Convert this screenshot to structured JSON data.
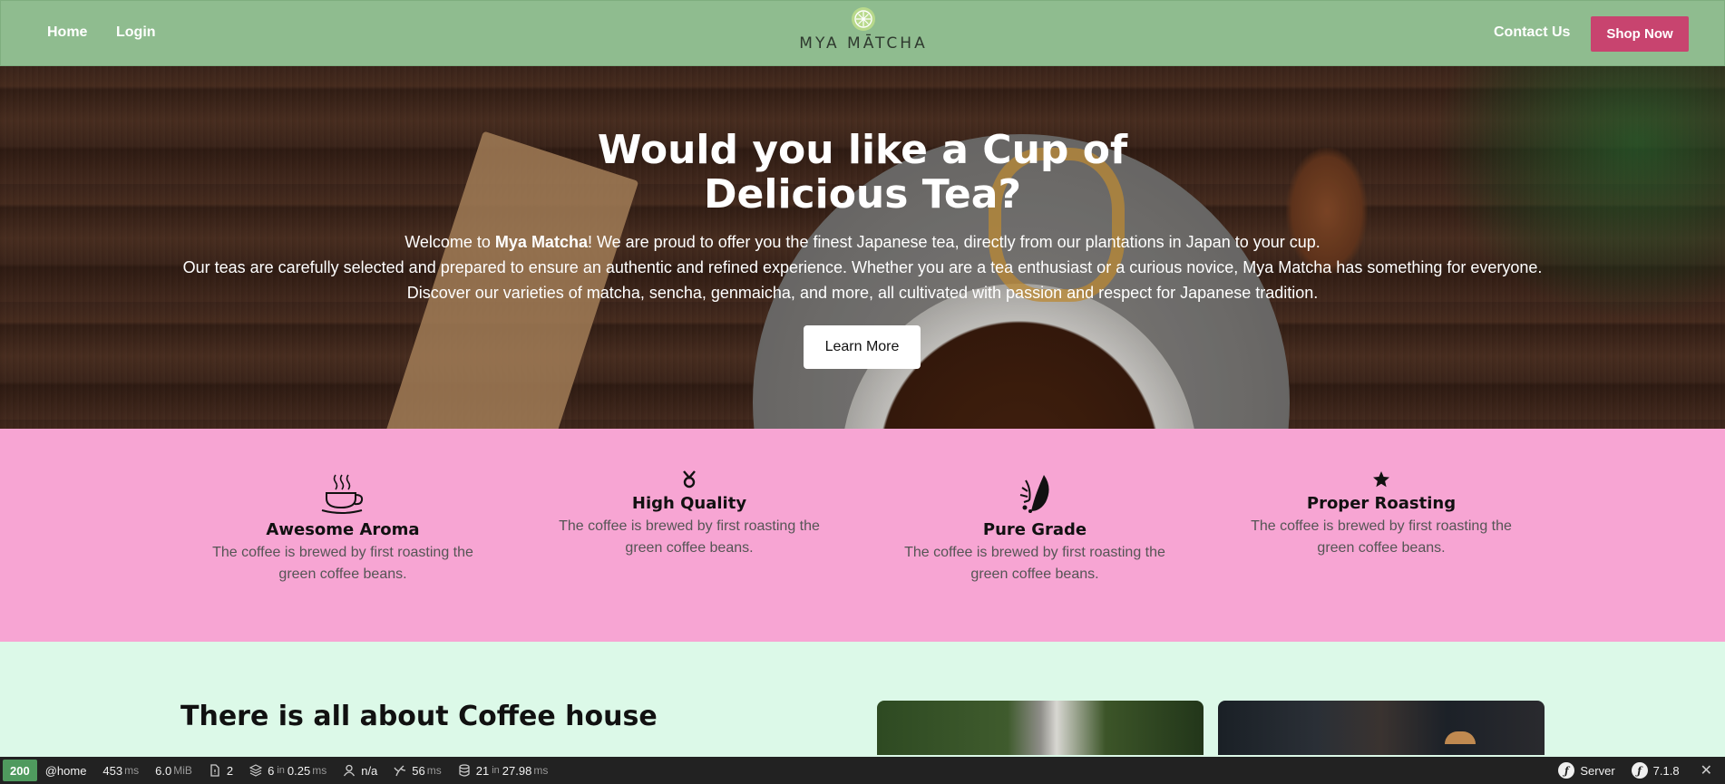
{
  "nav": {
    "home": "Home",
    "login": "Login",
    "contact": "Contact Us",
    "shop": "Shop Now",
    "brand": "MYA MĀTCHA"
  },
  "hero": {
    "title": "Would you like a Cup of Delicious Tea?",
    "line1_pre": "Welcome to ",
    "line1_brand": "Mya Matcha",
    "line1_post": "! We are proud to offer you the finest Japanese tea, directly from our plantations in Japan to your cup.",
    "line2": "Our teas are carefully selected and prepared to ensure an authentic and refined experience. Whether you are a tea enthusiast or a curious novice, Mya Matcha has something for everyone.",
    "line3": "Discover our varieties of matcha, sencha, genmaicha, and more, all cultivated with passion and respect for Japanese tradition.",
    "button": "Learn More"
  },
  "features": [
    {
      "title": "Awesome Aroma",
      "desc": "The coffee is brewed by first roasting the green coffee beans.",
      "icon": "coffee-cup-icon"
    },
    {
      "title": "High Quality",
      "desc": "The coffee is brewed by first roasting the green coffee beans.",
      "icon": "medal-icon"
    },
    {
      "title": "Pure Grade",
      "desc": "The coffee is brewed by first roasting the green coffee beans.",
      "icon": "leaf-icon"
    },
    {
      "title": "Proper Roasting",
      "desc": "The coffee is brewed by first roasting the green coffee beans.",
      "icon": "star-icon"
    }
  ],
  "about": {
    "title": "There is all about Coffee house"
  },
  "toolbar": {
    "status": "200",
    "route": "@home",
    "time_value": "453",
    "time_unit": "ms",
    "memory_value": "6.0",
    "memory_unit": "MiB",
    "logs": "2",
    "cache_count": "6",
    "cache_in": "in",
    "cache_time": "0.25",
    "cache_unit": "ms",
    "user": "n/a",
    "twig_value": "56",
    "twig_unit": "ms",
    "db_count": "21",
    "db_in": "in",
    "db_time": "27.98",
    "db_unit": "ms",
    "server": "Server",
    "version": "7.1.8",
    "close": "✕"
  },
  "colors": {
    "navbar": "#8fbc8f",
    "shop_button": "#c8446f",
    "features_bg": "#f7a5d3",
    "page_bg": "#dcf9e8",
    "status_ok": "#4f9a5e"
  }
}
